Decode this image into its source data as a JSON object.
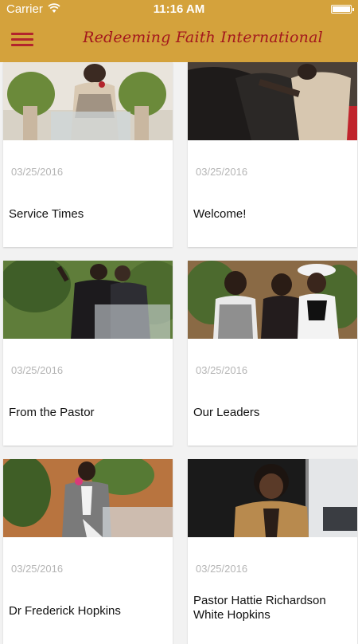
{
  "status_bar": {
    "carrier": "Carrier",
    "time": "11:16 AM"
  },
  "header": {
    "title": "Redeeming Faith International"
  },
  "cards": [
    {
      "date": "03/25/2016",
      "title": "Service Times",
      "image_icon": "pastor-at-podium-photo"
    },
    {
      "date": "03/25/2016",
      "title": "Welcome!",
      "image_icon": "congregation-photo"
    },
    {
      "date": "03/25/2016",
      "title": "From the Pastor",
      "image_icon": "pastor-preaching-photo"
    },
    {
      "date": "03/25/2016",
      "title": "Our Leaders",
      "image_icon": "leaders-group-photo"
    },
    {
      "date": "03/25/2016",
      "title": "Dr Frederick Hopkins",
      "image_icon": "dr-frederick-hopkins-photo"
    },
    {
      "date": "03/25/2016",
      "title": "Pastor Hattie Richardson White Hopkins",
      "image_icon": "pastor-hattie-photo"
    }
  ],
  "colors": {
    "header_bg": "#d4a23c",
    "brand_red": "#a3171d"
  }
}
